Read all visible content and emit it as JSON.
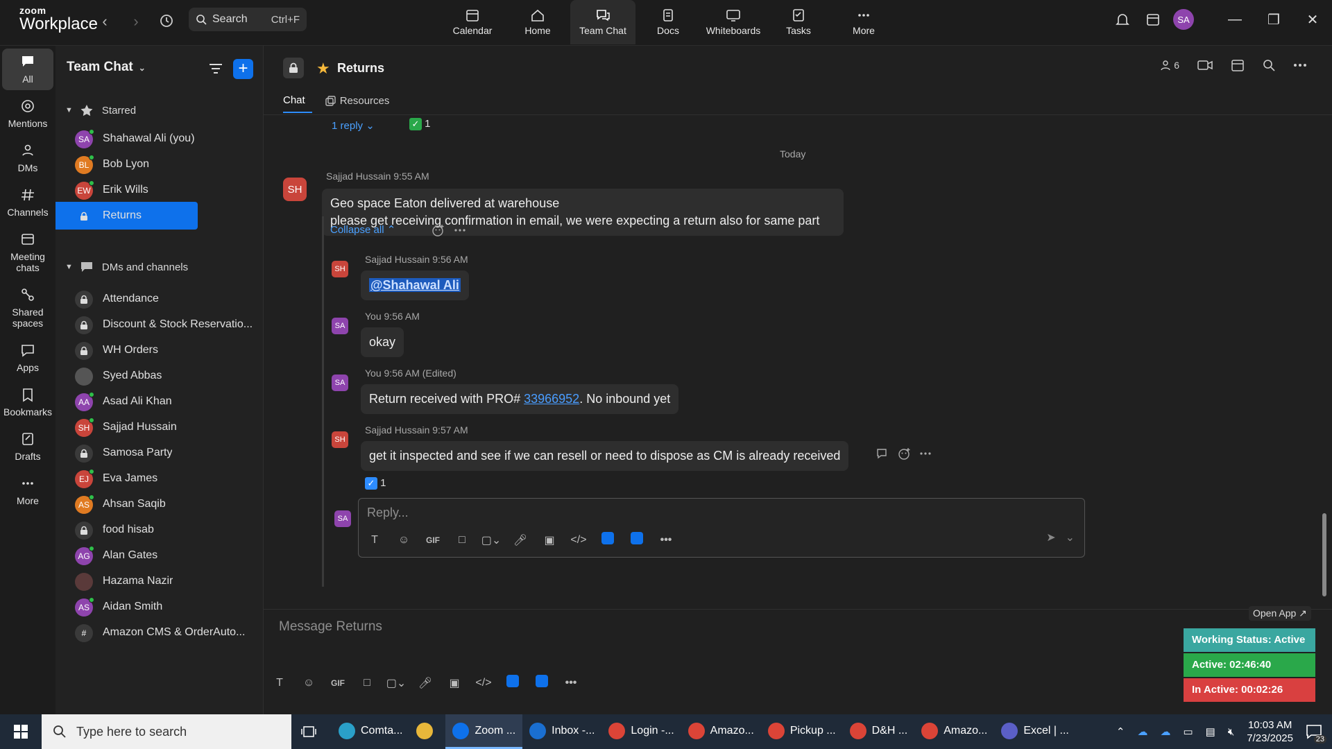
{
  "topbar": {
    "logo_line1": "zoom",
    "logo_line2": "Workplace",
    "search_label": "Search",
    "search_shortcut": "Ctrl+F",
    "nav": [
      {
        "label": "Calendar"
      },
      {
        "label": "Home"
      },
      {
        "label": "Team Chat"
      },
      {
        "label": "Docs"
      },
      {
        "label": "Whiteboards"
      },
      {
        "label": "Tasks"
      },
      {
        "label": "More"
      }
    ],
    "avatar_initials": "SA"
  },
  "rail": [
    {
      "label": "All"
    },
    {
      "label": "Mentions"
    },
    {
      "label": "DMs"
    },
    {
      "label": "Channels"
    },
    {
      "label": "Meeting chats"
    },
    {
      "label": "Shared spaces"
    },
    {
      "label": "Apps"
    },
    {
      "label": "Bookmarks"
    },
    {
      "label": "Drafts"
    },
    {
      "label": "More"
    }
  ],
  "sidebar": {
    "title": "Team Chat",
    "starred_label": "Starred",
    "starred": [
      {
        "initials": "SA",
        "label": "Shahawal Ali (you)",
        "color": "#8e44ad"
      },
      {
        "initials": "BL",
        "label": "Bob Lyon",
        "color": "#e07b22"
      },
      {
        "initials": "EW",
        "label": "Erik Wills",
        "color": "#c9453b"
      },
      {
        "initials": "",
        "label": "Returns",
        "color": "#0e71eb"
      }
    ],
    "dms_label": "DMs and channels",
    "dms": [
      {
        "initials": "",
        "label": "Attendance",
        "type": "lock"
      },
      {
        "initials": "",
        "label": "Discount & Stock Reservatio...",
        "type": "lock"
      },
      {
        "initials": "",
        "label": "WH Orders",
        "type": "lock"
      },
      {
        "initials": "",
        "label": "Syed Abbas",
        "type": "photo"
      },
      {
        "initials": "AA",
        "label": "Asad Ali Khan",
        "color": "#8e44ad"
      },
      {
        "initials": "SH",
        "label": "Sajjad Hussain",
        "color": "#c9453b"
      },
      {
        "initials": "",
        "label": "Samosa Party",
        "type": "lock"
      },
      {
        "initials": "EJ",
        "label": "Eva James",
        "color": "#c9453b"
      },
      {
        "initials": "AS",
        "label": "Ahsan Saqib",
        "color": "#e07b22"
      },
      {
        "initials": "",
        "label": "food hisab",
        "type": "lock"
      },
      {
        "initials": "AG",
        "label": "Alan Gates",
        "color": "#8e44ad"
      },
      {
        "initials": "",
        "label": "Hazama Nazir",
        "type": "photo2"
      },
      {
        "initials": "AS",
        "label": "Aidan Smith",
        "color": "#8e44ad"
      },
      {
        "initials": "#",
        "label": "Amazon CMS & OrderAuto...",
        "type": "hash"
      }
    ]
  },
  "channel": {
    "title": "Returns",
    "tab_chat": "Chat",
    "tab_resources": "Resources",
    "member_count": "6"
  },
  "thread": {
    "reply_count": "1 reply",
    "check_count": "1",
    "day_label": "Today",
    "parent": {
      "initials": "SH",
      "meta": "Sajjad Hussain 9:55 AM",
      "line1": "Geo space Eaton delivered at warehouse",
      "line2": "please get receiving confirmation in email, we were expecting a return also for same part"
    },
    "collapse_label": "Collapse all",
    "replies": [
      {
        "initials": "SH",
        "meta": "Sajjad Hussain 9:56 AM",
        "mention": "@Shahawal Ali"
      },
      {
        "initials": "SA",
        "meta": "You 9:56 AM",
        "text": "okay"
      },
      {
        "initials": "SA",
        "meta": "You 9:56 AM (Edited)",
        "prefix": "Return received with PRO# ",
        "link": "33966952",
        "suffix": ". No inbound yet"
      },
      {
        "initials": "SH",
        "meta": "Sajjad Hussain 9:57 AM",
        "text": "get it inspected and see if we can resell or need to dispose as CM is already received",
        "reaction_count": "1"
      }
    ],
    "reply_avatar": "SA",
    "reply_placeholder": "Reply..."
  },
  "compose": {
    "placeholder": "Message Returns"
  },
  "status_widget": {
    "open_app": "Open App ↗",
    "working": "Working Status: Active",
    "active": "Active: 02:46:40",
    "inactive": "In Active: 00:02:26",
    "colors": {
      "working": "#3aa7a0",
      "active": "#2aa84a",
      "inactive": "#d94040"
    }
  },
  "taskbar": {
    "search_placeholder": "Type here to search",
    "apps": [
      {
        "label": "Comta...",
        "color": "#2aa0c9"
      },
      {
        "label": "",
        "color": "#e8b73a"
      },
      {
        "label": "Zoom ...",
        "color": "#0e71eb"
      },
      {
        "label": "Inbox -...",
        "color": "#1a6fd1"
      },
      {
        "label": "Login -...",
        "color": "#db4437"
      },
      {
        "label": "Amazo...",
        "color": "#db4437"
      },
      {
        "label": "Pickup ...",
        "color": "#db4437"
      },
      {
        "label": "D&H ...",
        "color": "#db4437"
      },
      {
        "label": "Amazo...",
        "color": "#db4437"
      },
      {
        "label": "Excel | ...",
        "color": "#5b5fc7"
      }
    ],
    "time": "10:03 AM",
    "date": "7/23/2025",
    "notif_count": "23"
  }
}
